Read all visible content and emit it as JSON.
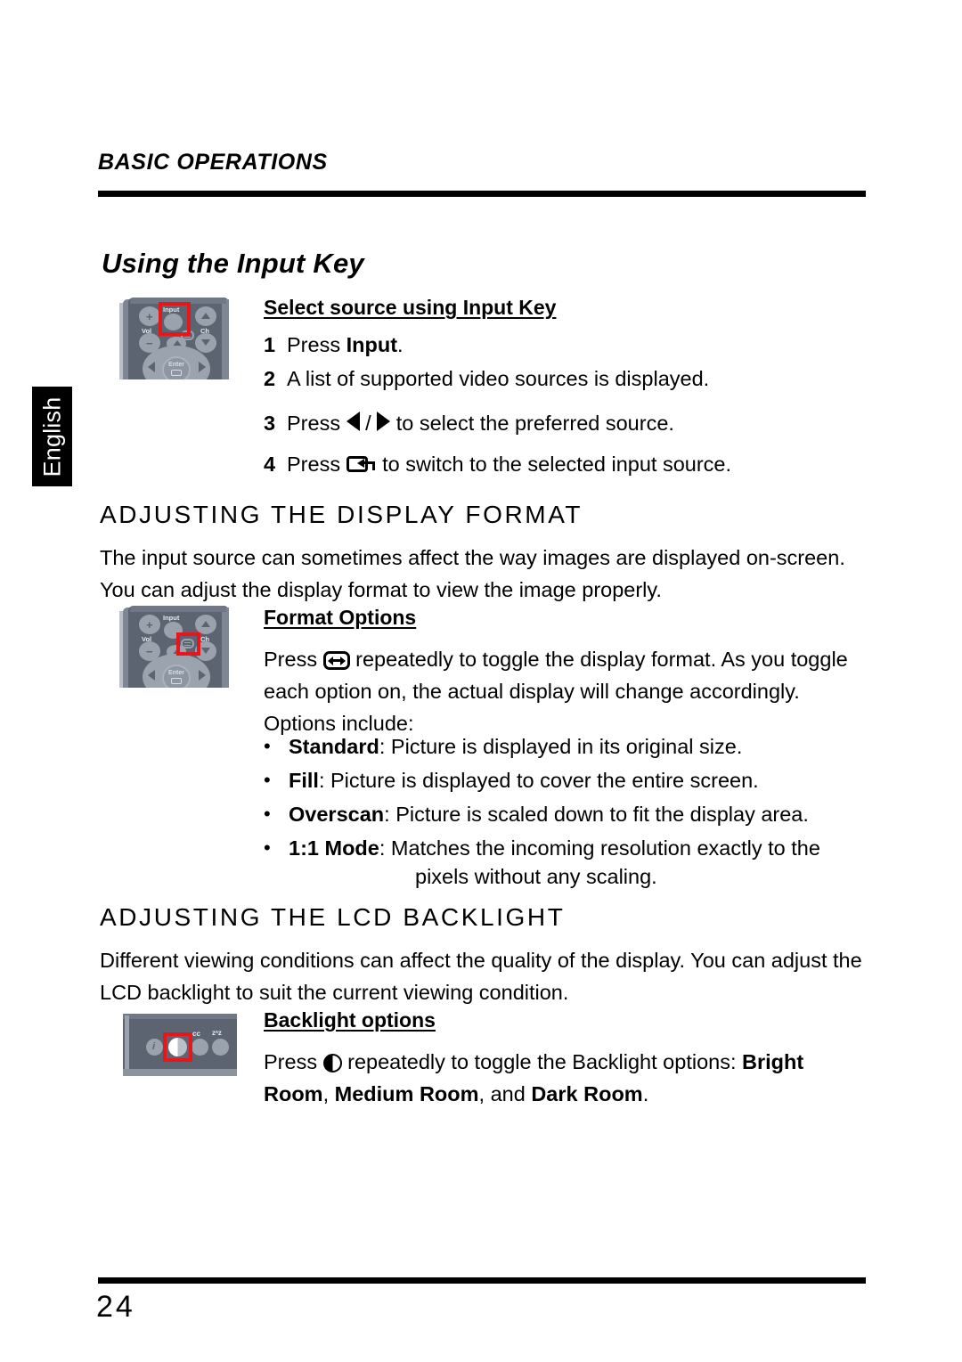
{
  "running_head": "BASIC OPERATIONS",
  "language_tab": "English",
  "title": "Using the Input Key",
  "input_key": {
    "sub_head": "Select source using Input Key",
    "steps": [
      {
        "num": "1",
        "pre": "Press ",
        "bold": "Input",
        "post": "."
      },
      {
        "num": "2",
        "pre": "A list of supported video sources is displayed.",
        "bold": "",
        "post": ""
      },
      {
        "num": "3",
        "pre": "Press ",
        "icon": "left-right-arrow-keys",
        "post": " to select the preferred source."
      },
      {
        "num": "4",
        "pre": "Press ",
        "icon": "enter-key",
        "post": " to switch to the selected input source."
      }
    ]
  },
  "display_format": {
    "section_title": "ADJUSTING THE DISPLAY FORMAT",
    "intro_line1": "The input source can sometimes affect the way images are displayed on-screen.",
    "intro_line2": "You can adjust the display format to view the image properly.",
    "sub_head": "Format Options",
    "body_pre": "Press ",
    "body_icon": "display-format-key",
    "body_post": " repeatedly to toggle the display format. As you toggle each option on, the actual display will change accordingly. Options include:",
    "options": [
      {
        "term": "Standard",
        "desc": ": Picture is displayed in its original size.",
        "cont": ""
      },
      {
        "term": "Fill",
        "desc": ": Picture is displayed to cover the entire screen.",
        "cont": ""
      },
      {
        "term": "Overscan",
        "desc": ": Picture is scaled down to fit the display area.",
        "cont": ""
      },
      {
        "term": "1:1 Mode",
        "desc": ": Matches the incoming resolution exactly to the",
        "cont": "pixels without any scaling."
      }
    ]
  },
  "backlight": {
    "section_title": "ADJUSTING THE LCD BACKLIGHT",
    "intro_line1": "Different viewing conditions can affect the quality of the display. You can adjust the",
    "intro_line2": "LCD backlight to suit the current viewing condition.",
    "sub_head": "Backlight options",
    "body_pre": "Press ",
    "body_icon": "backlight-key",
    "body_mid": " repeatedly to toggle the Backlight options: ",
    "opt1": "Bright Room",
    "sep1": ", ",
    "opt2": "Medium Room",
    "sep2": ", and ",
    "opt3": "Dark Room",
    "end": "."
  },
  "remote": {
    "vol_label": "Vol",
    "input_label": "Input",
    "ch_label": "Ch",
    "enter_label": "Enter",
    "plus": "+",
    "minus": "−",
    "highlight_color": "#e8161b"
  },
  "panel": {
    "info_label": "i",
    "cc_label": "cc",
    "sleep_label": "zᶺz",
    "highlight_color": "#e8161b"
  },
  "page_number": "24"
}
